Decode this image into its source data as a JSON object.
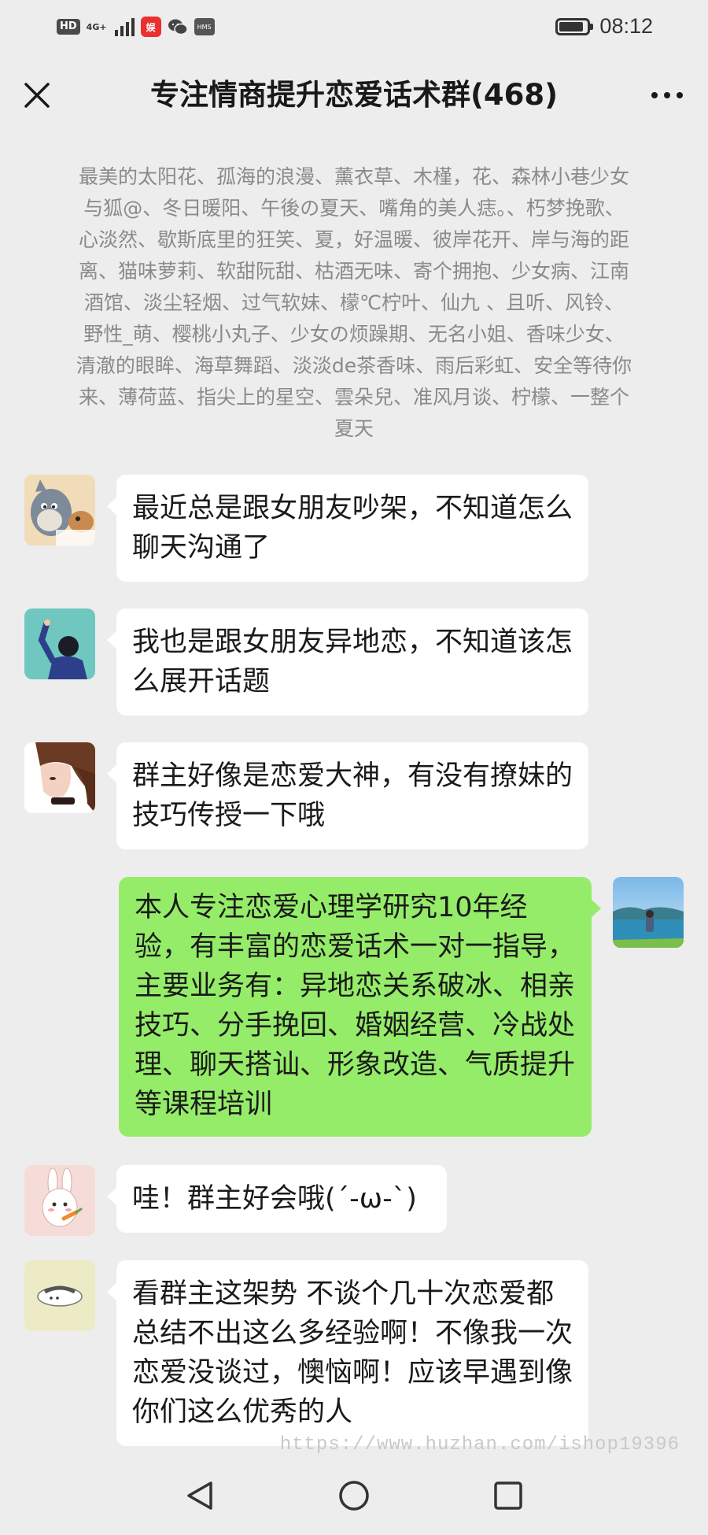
{
  "status_bar": {
    "hd": "HD",
    "network": "4G+",
    "app_badge": "娱",
    "hms": "HMS",
    "time": "08:12"
  },
  "header": {
    "title": "专注情商提升恋爱话术群(468)"
  },
  "notice": {
    "text": "最美的太阳花、孤海的浪漫、薰衣草、木槿，花、森林小巷少女与狐@、冬日暖阳、午後の夏天、嘴角的美人痣。、朽梦挽歌、心淡然、歇斯底里的狂笑、夏，好温暖、彼岸花开、岸与海的距离、猫味萝莉、软甜阮甜、枯酒无味、寄个拥抱、少女病、江南酒馆、淡尘轻烟、过气软妹、檬℃柠叶、仙九 、且听、风铃、野性_萌、樱桃小丸子、少女の烦躁期、无名小姐、香味少女、清澈的眼眸、海草舞蹈、淡淡de茶香味、雨后彩虹、安全等待你来、薄荷蓝、指尖上的星空、雲朵兒、准风月谈、柠檬、一整个夏天"
  },
  "messages": [
    {
      "side": "left",
      "avatar": "cartoon-cat-avatar",
      "text": "最近总是跟女朋友吵架，不知道怎么聊天沟通了"
    },
    {
      "side": "left",
      "avatar": "boy-illustration-avatar",
      "text": "我也是跟女朋友异地恋，不知道该怎么展开话题"
    },
    {
      "side": "left",
      "avatar": "girl-portrait-avatar",
      "text": "群主好像是恋爱大神，有没有撩妹的技巧传授一下哦"
    },
    {
      "side": "right",
      "avatar": "lake-landscape-avatar",
      "text": "本人专注恋爱心理学研究10年经验，有丰富的恋爱话术一对一指导，主要业务有：异地恋关系破冰、相亲技巧、分手挽回、婚姻经营、冷战处理、聊天搭讪、形象改造、气质提升等课程培训"
    },
    {
      "side": "left",
      "avatar": "bunny-avatar",
      "text": "哇！群主好会哦(´-ω-`)"
    },
    {
      "side": "left",
      "avatar": "rice-ball-avatar",
      "text": "看群主这架势 不谈个几十次恋爱都总结不出这么多经验啊！不像我一次恋爱没谈过，懊恼啊！应该早遇到像你们这么优秀的人"
    }
  ],
  "watermark": "https://www.huzhan.com/ishop19396",
  "colors": {
    "background": "#ededed",
    "bubble_left": "#ffffff",
    "bubble_right": "#95ec69",
    "notice_text": "#8a8a8a"
  }
}
